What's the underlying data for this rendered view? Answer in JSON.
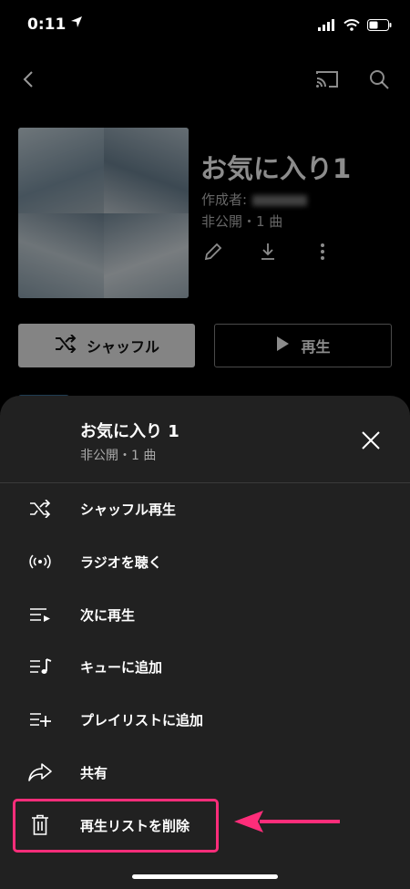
{
  "status_bar": {
    "time": "0:11"
  },
  "playlist": {
    "title": "お気に入り1",
    "owner_label": "作成者:",
    "meta": "非公開・1 曲",
    "shuffle_label": "シャッフル",
    "play_label": "再生"
  },
  "sheet": {
    "title": "お気に入り 1",
    "subtitle": "非公開・1 曲",
    "items": [
      {
        "label": "シャッフル再生",
        "icon": "shuffle-icon"
      },
      {
        "label": "ラジオを聴く",
        "icon": "radio-icon"
      },
      {
        "label": "次に再生",
        "icon": "play-next-icon"
      },
      {
        "label": "キューに追加",
        "icon": "add-to-queue-icon"
      },
      {
        "label": "プレイリストに追加",
        "icon": "add-to-playlist-icon"
      },
      {
        "label": "共有",
        "icon": "share-icon"
      },
      {
        "label": "再生リストを削除",
        "icon": "trash-icon"
      }
    ]
  },
  "colors": {
    "highlight": "#ff2d7a",
    "sheet_bg": "#212121",
    "background": "#000000"
  }
}
